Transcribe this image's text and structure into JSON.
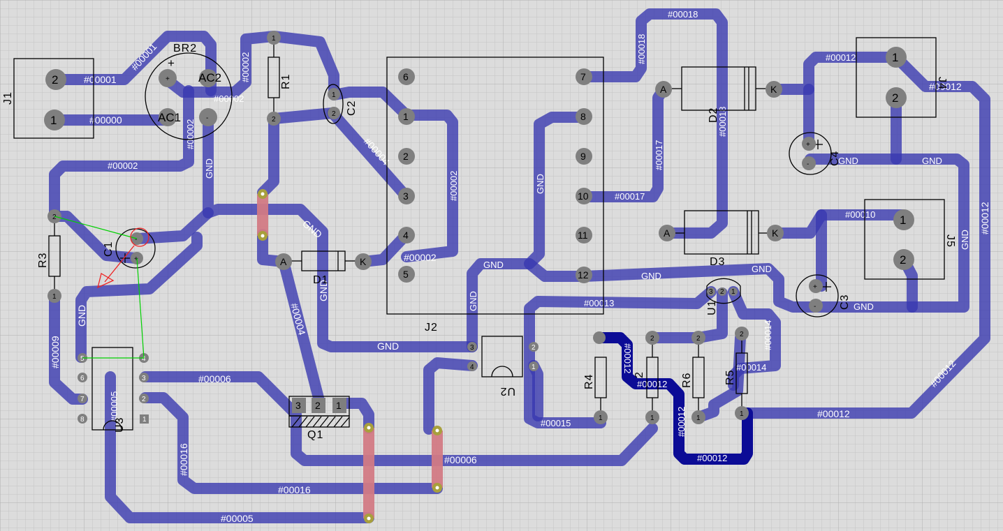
{
  "app": {
    "view": "PCB Layout"
  },
  "colors": {
    "background": "#dcdcdc",
    "grid_minor": "#c4c4c4",
    "grid_major": "#b2b2b2",
    "track": "#3737af",
    "track_selected": "#0c0c96",
    "jumper": "#d27a84",
    "pad": "#7f7f7f",
    "ratsnest": "#00d000",
    "marker": "#ee2222"
  },
  "nets": {
    "n00000": "#00000",
    "n00001": "#00001",
    "n00002": "#00002",
    "n00004": "#00004",
    "n00005": "#00005",
    "n00006": "#00006",
    "n00009": "#00009",
    "n00010": "#00010",
    "n00012": "#00012",
    "n00013": "#00013",
    "n00014": "#00014",
    "n00015": "#00015",
    "n00016": "#00016",
    "n00017": "#00017",
    "n00018": "#00018",
    "gnd": "GND"
  },
  "components": {
    "J1": {
      "ref": "J1",
      "pins": [
        "2",
        "1"
      ]
    },
    "BR2": {
      "ref": "BR2",
      "pins": [
        "+",
        "AC2",
        "AC1",
        "-"
      ]
    },
    "R1": {
      "ref": "R1",
      "pins": [
        "1",
        "2"
      ]
    },
    "C2": {
      "ref": "C2",
      "pins": [
        "1",
        "2"
      ]
    },
    "J2": {
      "ref": "J2",
      "pins": [
        "6",
        "1",
        "2",
        "3",
        "4",
        "5",
        "7",
        "8",
        "9",
        "10",
        "11",
        "12"
      ]
    },
    "D1": {
      "ref": "D1",
      "pins": [
        "A",
        "K"
      ]
    },
    "D2": {
      "ref": "D2",
      "pins": [
        "A",
        "K"
      ]
    },
    "D3": {
      "ref": "D3",
      "pins": [
        "A",
        "K"
      ]
    },
    "J4": {
      "ref": "J4",
      "pins": [
        "1",
        "2"
      ]
    },
    "J5": {
      "ref": "J5",
      "pins": [
        "1",
        "2"
      ]
    },
    "C4": {
      "ref": "C4",
      "pins": [
        "+",
        "-"
      ]
    },
    "C3": {
      "ref": "C3",
      "pins": [
        "+",
        "-"
      ]
    },
    "C1": {
      "ref": "C1",
      "pins": [
        "-",
        "+"
      ]
    },
    "R3": {
      "ref": "R3",
      "pins": [
        "2",
        "1"
      ]
    },
    "U3": {
      "ref": "U3",
      "pins": [
        "8",
        "7",
        "6",
        "5",
        "1",
        "2",
        "3",
        "4"
      ]
    },
    "Q1": {
      "ref": "Q1",
      "pins": [
        "3",
        "2",
        "1"
      ]
    },
    "U2": {
      "ref": "U2",
      "pins": [
        "3",
        "4",
        "2",
        "1"
      ]
    },
    "U1": {
      "ref": "U1",
      "pins": [
        "3",
        "2",
        "1"
      ]
    },
    "R4": {
      "ref": "R4",
      "pins": [
        "1"
      ]
    },
    "R2": {
      "ref": "2",
      "pins": [
        "2",
        "1"
      ]
    },
    "R6": {
      "ref": "R6",
      "pins": [
        "2",
        "1"
      ]
    },
    "R5": {
      "ref": "R5",
      "pins": [
        "2",
        "1"
      ]
    }
  }
}
